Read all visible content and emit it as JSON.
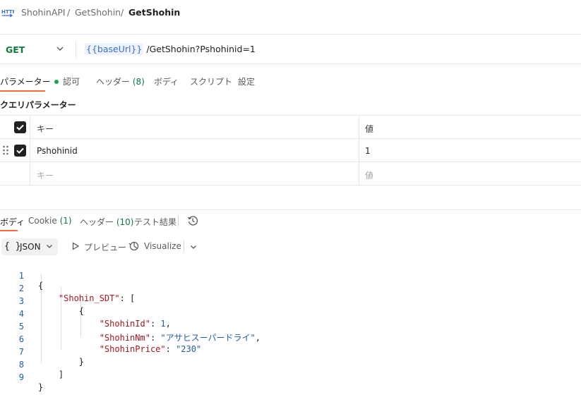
{
  "breadcrumb": {
    "icon": "http-icon",
    "icon_label": "HTTP",
    "items": [
      "ShohinAPI",
      "GetShohin",
      "GetShohin"
    ],
    "separator": "/"
  },
  "request": {
    "method": "GET",
    "url_variable": "{{baseUrl}}",
    "url_rest": "/GetShohin?Pshohinid=1"
  },
  "request_tabs": [
    {
      "label": "パラメーター",
      "active": true,
      "dot": true
    },
    {
      "label": "認可"
    },
    {
      "label": "ヘッダー",
      "count": "(8)"
    },
    {
      "label": "ボディ"
    },
    {
      "label": "スクリプト"
    },
    {
      "label": "設定"
    }
  ],
  "query_params": {
    "title": "クエリパラメーター",
    "columns": {
      "key": "キー",
      "value": "値"
    },
    "rows": [
      {
        "key": "Pshohinid",
        "value": "1",
        "checked": true
      }
    ],
    "placeholder": {
      "key": "キー",
      "value": "値"
    }
  },
  "response_tabs": [
    {
      "label": "ボディ",
      "active": true
    },
    {
      "label": "Cookie",
      "count": "(1)"
    },
    {
      "label": "ヘッダー",
      "count": "(10)"
    },
    {
      "label": "テスト結果"
    }
  ],
  "response_toolbar": {
    "format_braces": "{ }",
    "format": "JSON",
    "preview": "プレビュー",
    "visualize": "Visualize"
  },
  "code": {
    "line_numbers": [
      "1",
      "2",
      "3",
      "4",
      "5",
      "6",
      "7",
      "8",
      "9"
    ],
    "key_shohin_sdt": "\"Shohin_SDT\"",
    "key_id": "\"ShohinId\"",
    "val_id": "1",
    "key_nm": "\"ShohinNm\"",
    "val_nm": "\"アサヒスーパードライ\"",
    "key_price": "\"ShohinPrice\"",
    "val_price": "\"230\""
  },
  "colors": {
    "method_get": "#0b7a3e",
    "accent": "#ff6c37",
    "variable": "#3b6fd6",
    "json_key": "#a3151f",
    "json_value": "#1f5fa8"
  }
}
